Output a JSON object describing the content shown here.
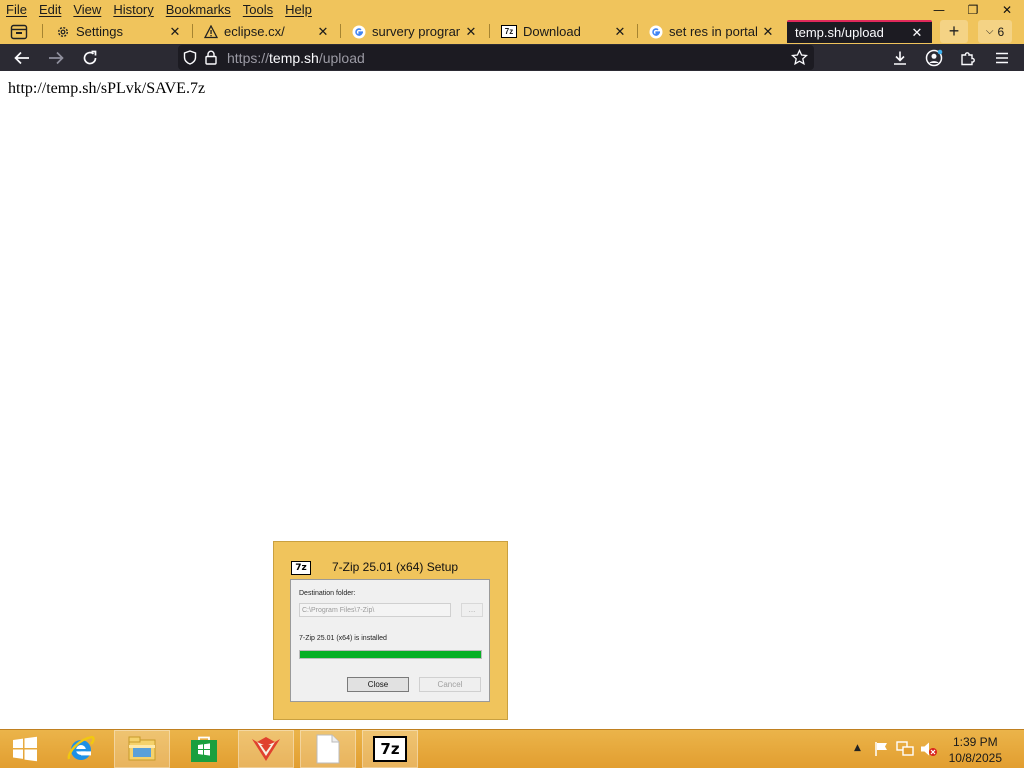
{
  "menu": [
    "File",
    "Edit",
    "View",
    "History",
    "Bookmarks",
    "Tools",
    "Help"
  ],
  "window_controls": {
    "minimize": "—",
    "restore": "❐",
    "close": "✕"
  },
  "tabs": [
    {
      "label": "Settings",
      "icon": "gear-icon",
      "active": false
    },
    {
      "label": "eclipse.cx/",
      "icon": "warning-icon",
      "active": false
    },
    {
      "label": "survery program",
      "icon": "google-icon",
      "active": false
    },
    {
      "label": "Download",
      "icon": "7zip-icon",
      "active": false
    },
    {
      "label": "set res in portal u",
      "icon": "google-icon",
      "active": false
    },
    {
      "label": "temp.sh/upload",
      "icon": "",
      "active": true
    }
  ],
  "tab_count": "6",
  "url": {
    "scheme": "https://",
    "host": "temp.sh",
    "path": "/upload"
  },
  "page_text": "http://temp.sh/sPLvk/SAVE.7z",
  "dialog": {
    "icon_text": "7z",
    "title": "7-Zip 25.01 (x64) Setup",
    "dest_label": "Destination folder:",
    "dest_path": "C:\\Program Files\\7-Zip\\",
    "browse": "...",
    "status": "7-Zip 25.01 (x64) is installed",
    "progress": 1.0,
    "close_label": "Close",
    "cancel_label": "Cancel"
  },
  "taskbar": {
    "apps": [
      "start-icon",
      "internet-explorer-icon",
      "file-explorer-icon",
      "store-icon",
      "firefox-icon",
      "notepad-icon",
      "7zip-icon"
    ],
    "sevenzip_label": "7z",
    "time": "1:39 PM",
    "date": "10/8/2025"
  },
  "colors": {
    "accent": "#f0c45c",
    "toolbar": "#2b2a33",
    "active_tab": "#1c1b22",
    "tab_highlight": "#e0295b",
    "progress": "#06b025"
  }
}
